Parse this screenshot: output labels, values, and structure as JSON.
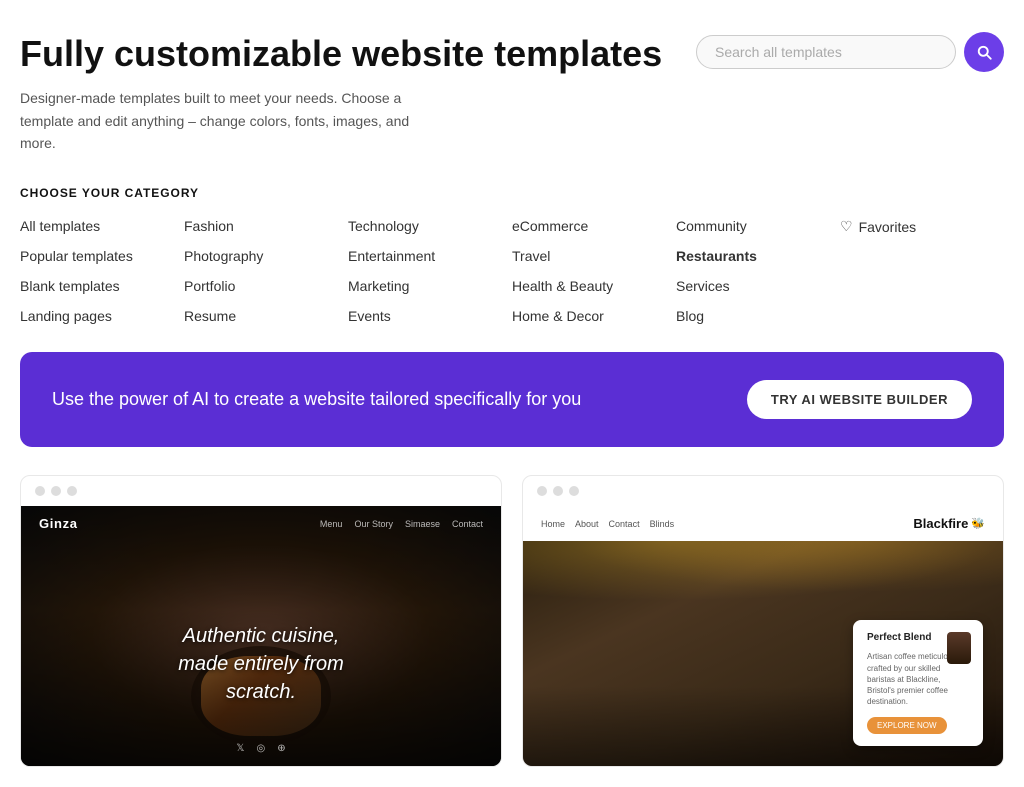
{
  "header": {
    "title": "Fully customizable website templates",
    "subtitle": "Designer-made templates built to meet your needs. Choose a template and edit anything – change colors, fonts, images, and more.",
    "search": {
      "placeholder": "Search all templates",
      "button_label": "search"
    }
  },
  "categories": {
    "section_label": "CHOOSE YOUR CATEGORY",
    "columns": [
      {
        "items": [
          {
            "label": "All templates",
            "bold": false
          },
          {
            "label": "Popular templates",
            "bold": false
          },
          {
            "label": "Blank templates",
            "bold": false
          },
          {
            "label": "Landing pages",
            "bold": false
          }
        ]
      },
      {
        "items": [
          {
            "label": "Fashion",
            "bold": false
          },
          {
            "label": "Photography",
            "bold": false
          },
          {
            "label": "Portfolio",
            "bold": false
          },
          {
            "label": "Resume",
            "bold": false
          }
        ]
      },
      {
        "items": [
          {
            "label": "Technology",
            "bold": false
          },
          {
            "label": "Entertainment",
            "bold": false
          },
          {
            "label": "Marketing",
            "bold": false
          },
          {
            "label": "Events",
            "bold": false
          }
        ]
      },
      {
        "items": [
          {
            "label": "eCommerce",
            "bold": false
          },
          {
            "label": "Travel",
            "bold": false
          },
          {
            "label": "Health & Beauty",
            "bold": false
          },
          {
            "label": "Home & Decor",
            "bold": false
          }
        ]
      },
      {
        "items": [
          {
            "label": "Community",
            "bold": false
          },
          {
            "label": "Restaurants",
            "bold": true
          },
          {
            "label": "Services",
            "bold": false
          },
          {
            "label": "Blog",
            "bold": false
          }
        ]
      },
      {
        "items": [
          {
            "label": "Favorites",
            "bold": false,
            "heart": true
          }
        ]
      }
    ]
  },
  "ai_banner": {
    "text": "Use the power of AI to create a website tailored specifically for you",
    "button_label": "TRY AI WEBSITE BUILDER",
    "bg_color": "#5b2ed4"
  },
  "templates": [
    {
      "name": "Ginza",
      "nav_links": [
        "Menu",
        "Our Story",
        "Simaese",
        "Contact"
      ],
      "heading": "Authentic cuisine,\nmade entirely from\nscratch.",
      "social_icons": [
        "𝕏",
        "◎",
        "📷"
      ]
    },
    {
      "name": "Blackfire",
      "nav_links": [
        "Home",
        "About",
        "Contact",
        "Blinds"
      ],
      "card_title": "Perfect Blend",
      "card_text": "Artisan coffee meticulously crafted by our skilled baristas at Blackline, Bristol's premier coffee destination.",
      "card_btn": "EXPLORE NOW"
    }
  ]
}
